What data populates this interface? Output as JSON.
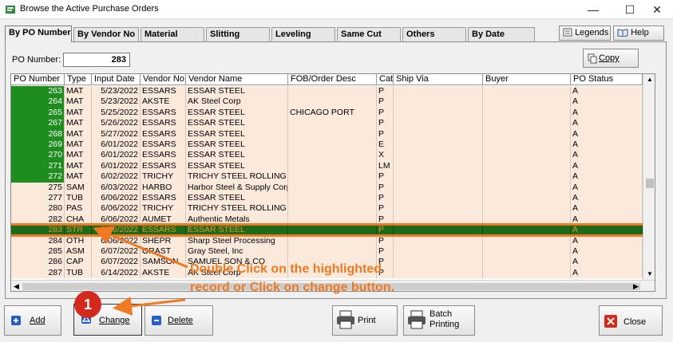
{
  "window": {
    "title": "Browse the Active Purchase Orders",
    "minimize_glyph": "—",
    "maximize_glyph": "☐",
    "close_glyph": "✕"
  },
  "tabs": [
    {
      "label": "By PO Number",
      "active": true
    },
    {
      "label": "By Vendor No"
    },
    {
      "label": "Material"
    },
    {
      "label": "Slitting"
    },
    {
      "label": "Leveling"
    },
    {
      "label": "Same Cut"
    },
    {
      "label": "Others"
    },
    {
      "label": "By Date"
    }
  ],
  "toolbar": {
    "legends_label": "Legends",
    "help_label": "Help"
  },
  "po_filter": {
    "label": "PO Number:",
    "value": "283"
  },
  "copy_button": {
    "label": "Copy"
  },
  "grid": {
    "columns": [
      "PO Number",
      "Type",
      "Input Date",
      "Vendor No",
      "Vendor Name",
      "FOB/Order Desc",
      "Cat",
      "Ship Via",
      "Buyer",
      "PO Status"
    ],
    "rows": [
      {
        "po": "263",
        "type": "MAT",
        "date": "5/23/2022",
        "vendor_no": "ESSARS",
        "vendor_name": "ESSAR STEEL",
        "fob": "",
        "cat": "P",
        "status": "A",
        "green": true
      },
      {
        "po": "264",
        "type": "MAT",
        "date": "5/23/2022",
        "vendor_no": "AKSTE",
        "vendor_name": "AK Steel Corp",
        "fob": "",
        "cat": "P",
        "status": "A",
        "green": true
      },
      {
        "po": "265",
        "type": "MAT",
        "date": "5/25/2022",
        "vendor_no": "ESSARS",
        "vendor_name": "ESSAR STEEL",
        "fob": "CHICAGO PORT",
        "cat": "P",
        "status": "A",
        "green": true
      },
      {
        "po": "267",
        "type": "MAT",
        "date": "5/26/2022",
        "vendor_no": "ESSARS",
        "vendor_name": "ESSAR STEEL",
        "fob": "",
        "cat": "P",
        "status": "A",
        "green": true
      },
      {
        "po": "268",
        "type": "MAT",
        "date": "5/27/2022",
        "vendor_no": "ESSARS",
        "vendor_name": "ESSAR STEEL",
        "fob": "",
        "cat": "P",
        "status": "A",
        "green": true
      },
      {
        "po": "269",
        "type": "MAT",
        "date": "6/01/2022",
        "vendor_no": "ESSARS",
        "vendor_name": "ESSAR STEEL",
        "fob": "",
        "cat": "E",
        "status": "A",
        "green": true
      },
      {
        "po": "270",
        "type": "MAT",
        "date": "6/01/2022",
        "vendor_no": "ESSARS",
        "vendor_name": "ESSAR STEEL",
        "fob": "",
        "cat": "X",
        "status": "A",
        "green": true
      },
      {
        "po": "271",
        "type": "MAT",
        "date": "6/01/2022",
        "vendor_no": "ESSARS",
        "vendor_name": "ESSAR STEEL",
        "fob": "",
        "cat": "LM",
        "status": "A",
        "green": true
      },
      {
        "po": "272",
        "type": "MAT",
        "date": "6/02/2022",
        "vendor_no": "TRICHY",
        "vendor_name": "TRICHY STEEL ROLLING MI",
        "fob": "",
        "cat": "P",
        "status": "A",
        "green": true
      },
      {
        "po": "275",
        "type": "SAM",
        "date": "6/03/2022",
        "vendor_no": "HARBO",
        "vendor_name": "Harbor Steel & Supply Corp",
        "fob": "",
        "cat": "P",
        "status": "A",
        "green": false
      },
      {
        "po": "277",
        "type": "TUB",
        "date": "6/06/2022",
        "vendor_no": "ESSARS",
        "vendor_name": "ESSAR STEEL",
        "fob": "",
        "cat": "P",
        "status": "A",
        "green": false
      },
      {
        "po": "280",
        "type": "PAS",
        "date": "6/06/2022",
        "vendor_no": "TRICHY",
        "vendor_name": "TRICHY STEEL ROLLING MI",
        "fob": "",
        "cat": "P",
        "status": "A",
        "green": false
      },
      {
        "po": "282",
        "type": "CHA",
        "date": "6/06/2022",
        "vendor_no": "AUMET",
        "vendor_name": "Authentic Metals",
        "fob": "",
        "cat": "P",
        "status": "A",
        "green": false
      },
      {
        "po": "283",
        "type": "STR",
        "date": "6/06/2022",
        "vendor_no": "ESSARS",
        "vendor_name": "ESSAR STEEL",
        "fob": "",
        "cat": "P",
        "status": "A",
        "green": false,
        "selected": true
      },
      {
        "po": "284",
        "type": "OTH",
        "date": "6/06/2022",
        "vendor_no": "SHEPR",
        "vendor_name": "Sharp Steel Processing",
        "fob": "",
        "cat": "P",
        "status": "A",
        "green": false
      },
      {
        "po": "285",
        "type": "ASM",
        "date": "6/07/2022",
        "vendor_no": "GRAST",
        "vendor_name": "Gray Steel, Inc",
        "fob": "",
        "cat": "P",
        "status": "A",
        "green": false
      },
      {
        "po": "286",
        "type": "CAP",
        "date": "6/07/2022",
        "vendor_no": "SAMSON",
        "vendor_name": "SAMUEL SON & CO",
        "fob": "",
        "cat": "P",
        "status": "A",
        "green": false
      },
      {
        "po": "287",
        "type": "TUB",
        "date": "6/14/2022",
        "vendor_no": "AKSTE",
        "vendor_name": "AK Steel Corp",
        "fob": "",
        "cat": "P",
        "status": "A",
        "green": false
      }
    ]
  },
  "buttons": {
    "add": "Add",
    "change": "Change",
    "delete": "Delete",
    "print": "Print",
    "batch_printing": "Batch\nPrinting",
    "close": "Close"
  },
  "annotation": {
    "line1": "Double Click on the highlighted",
    "line2": "record or Click on change button.",
    "step": "1",
    "color": "#f07a22"
  }
}
